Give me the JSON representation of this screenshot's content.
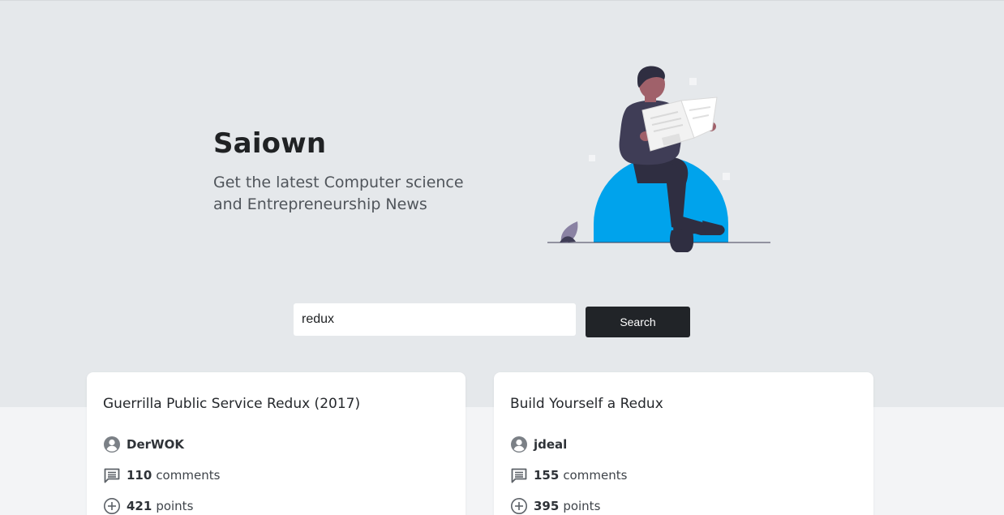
{
  "hero": {
    "title": "Saiown",
    "subtitle": "Get the latest Computer science and Entrepreneurship News"
  },
  "search": {
    "value": "redux",
    "button_label": "Search"
  },
  "colors": {
    "hero_bg": "#e5e8eb",
    "page_bg": "#f3f4f6",
    "accent_blue": "#00a3ec",
    "button_dark": "#212428"
  },
  "results": [
    {
      "title": "Guerrilla Public Service Redux (2017)",
      "author": "DerWOK",
      "comments": "110",
      "comments_label": "comments",
      "points": "421",
      "points_label": "points"
    },
    {
      "title": "Build Yourself a Redux",
      "author": "jdeal",
      "comments": "155",
      "comments_label": "comments",
      "points": "395",
      "points_label": "points"
    }
  ],
  "icons": {
    "author": "user-circle-icon",
    "comments": "comment-icon",
    "points": "plus-circle-icon"
  }
}
